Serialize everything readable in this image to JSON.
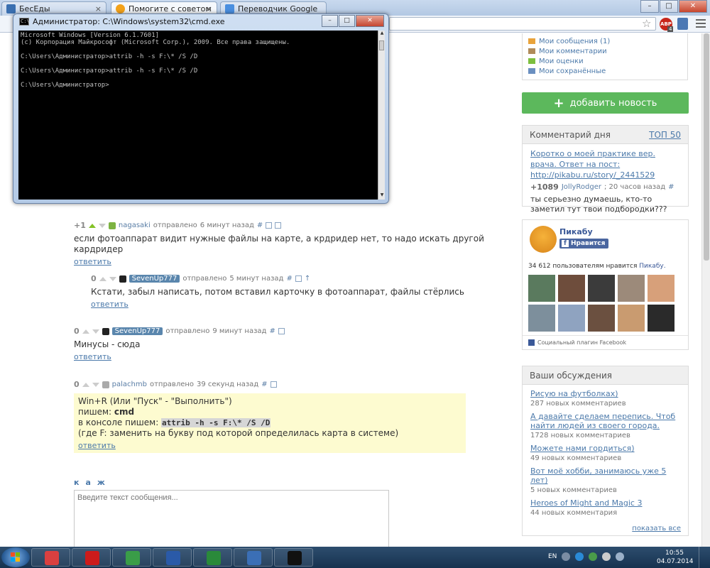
{
  "tabs": [
    {
      "label": "БесЕды",
      "icon_color": "#3a6fb0"
    },
    {
      "label": "Помогите с советом",
      "icon_color": "#f3a21a"
    },
    {
      "label": "Переводчик Google",
      "icon_color": "#4a8fe0"
    }
  ],
  "browser_controls": {
    "minimize": "–",
    "maximize": "□",
    "close": "✕",
    "tab_close": "×",
    "abp": "ABP",
    "abp_count": "4"
  },
  "cmd": {
    "title": "Администратор: C:\\Windows\\system32\\cmd.exe",
    "lines": "Microsoft Windows [Version 6.1.7601]\n(c) Корпорация Майкрософт (Microsoft Corp.), 2009. Все права защищены.\n\nC:\\Users\\Администратор>attrib -h -s F:\\* /S /D\n\nC:\\Users\\Администратор>attrib -h -s F:\\* /S /D\n\nC:\\Users\\Администратор>"
  },
  "comments": [
    {
      "score": "+1",
      "user": "nagasaki",
      "verb": "отправлено",
      "time": "6 минут назад",
      "hash": "#",
      "text": "если фотоаппарат видит нужные файлы на карте, а крдридер нет, то надо искать другой кардридер",
      "reply": "ответить"
    },
    {
      "score": "0",
      "user": "SevenUp777",
      "verb": "отправлено",
      "time": "5 минут назад",
      "hash": "#",
      "up": "↑",
      "text": "Кстати, забыл написать, потом вставил карточку в фотоаппарат, файлы стёрлись",
      "reply": "ответить"
    },
    {
      "score": "0",
      "user": "SevenUp777",
      "verb": "отправлено",
      "time": "9 минут назад",
      "hash": "#",
      "text": "Минусы - сюда",
      "reply": "ответить"
    },
    {
      "score": "0",
      "user": "palachmb",
      "verb": "отправлено",
      "time": "39 секунд назад",
      "hash": "#",
      "line1": "Win+R (Или \"Пуск\" - \"Выполнить\")",
      "line2_prefix": "пишем: ",
      "line2_code": "cmd",
      "line3_prefix": "в консоле пишем: ",
      "line3_code": "attrib -h -s F:\\* /S /D",
      "line4": "(где F: заменить на букву под которой определилась карта в системе)",
      "reply": "ответить"
    }
  ],
  "editor": {
    "formats": [
      "к",
      "а",
      "ж"
    ],
    "placeholder": "Введите текст сообщения..."
  },
  "sidebar": {
    "my_links": [
      {
        "label": "Мои сообщения (1)",
        "icon_color": "#e9a33b"
      },
      {
        "label": "Мои комментарии",
        "icon_color": "#b08b5a"
      },
      {
        "label": "Мои оценки",
        "icon_color": "#7dbf3e"
      },
      {
        "label": "Мои сохранённые",
        "icon_color": "#6a8fc0"
      }
    ],
    "add_button": "добавить новость",
    "add_button_plus": "+",
    "comment_of_day": {
      "header": "Комментарий дня",
      "top": "ТОП 50",
      "link": "Коротко о моей практике вер. врача. Ответ на пост: http://pikabu.ru/story/_2441529",
      "score": "+1089",
      "user": "JollyRodger",
      "time": "; 20 часов назад",
      "hash": "#",
      "text": "ты серьезно думаешь, кто-то заметил тут твои подбородки???"
    },
    "facebook": {
      "name": "Пикабу",
      "like": "Нравится",
      "like_icon": "f",
      "count_text": "34 612 пользователям нравится ",
      "count_link": "Пикабу.",
      "plugin": "Социальный плагин Facebook",
      "face_colors": [
        "#5a7a5e",
        "#6e4d3c",
        "#3b3b3b",
        "#9c8a7a",
        "#d7a07a",
        "#7d8f9c",
        "#8fa3c0",
        "#6b5040",
        "#c99b70",
        "#2a2a2a"
      ]
    },
    "discussions": {
      "header": "Ваши обсуждения",
      "items": [
        {
          "link": "Рисую на футболках)",
          "count": "287 новых комментариев"
        },
        {
          "link": "А давайте сделаем перепись. Чтоб найти людей из своего города.",
          "count": "1728 новых комментариев"
        },
        {
          "link": "Можете нами гордиться)",
          "count": "49 новых комментариев"
        },
        {
          "link": "Вот моё хобби, занимаюсь уже 5 лет)",
          "count": "5 новых комментариев"
        },
        {
          "link": "Heroes of Might and Magic 3",
          "count": "44 новых комментария"
        }
      ],
      "show_all": "показать все"
    }
  },
  "taskbar": {
    "apps": [
      {
        "name": "snipping",
        "color": "#d94040"
      },
      {
        "name": "opera",
        "color": "#cc1b1b"
      },
      {
        "name": "chrome",
        "color": "#3a9d48"
      },
      {
        "name": "word",
        "color": "#2a5aa8"
      },
      {
        "name": "excel",
        "color": "#2a8a3a"
      },
      {
        "name": "sp",
        "color": "#3b6fb6"
      },
      {
        "name": "cmd",
        "color": "#111111"
      }
    ],
    "lang": "EN",
    "time": "10:55",
    "date": "04.07.2014"
  }
}
